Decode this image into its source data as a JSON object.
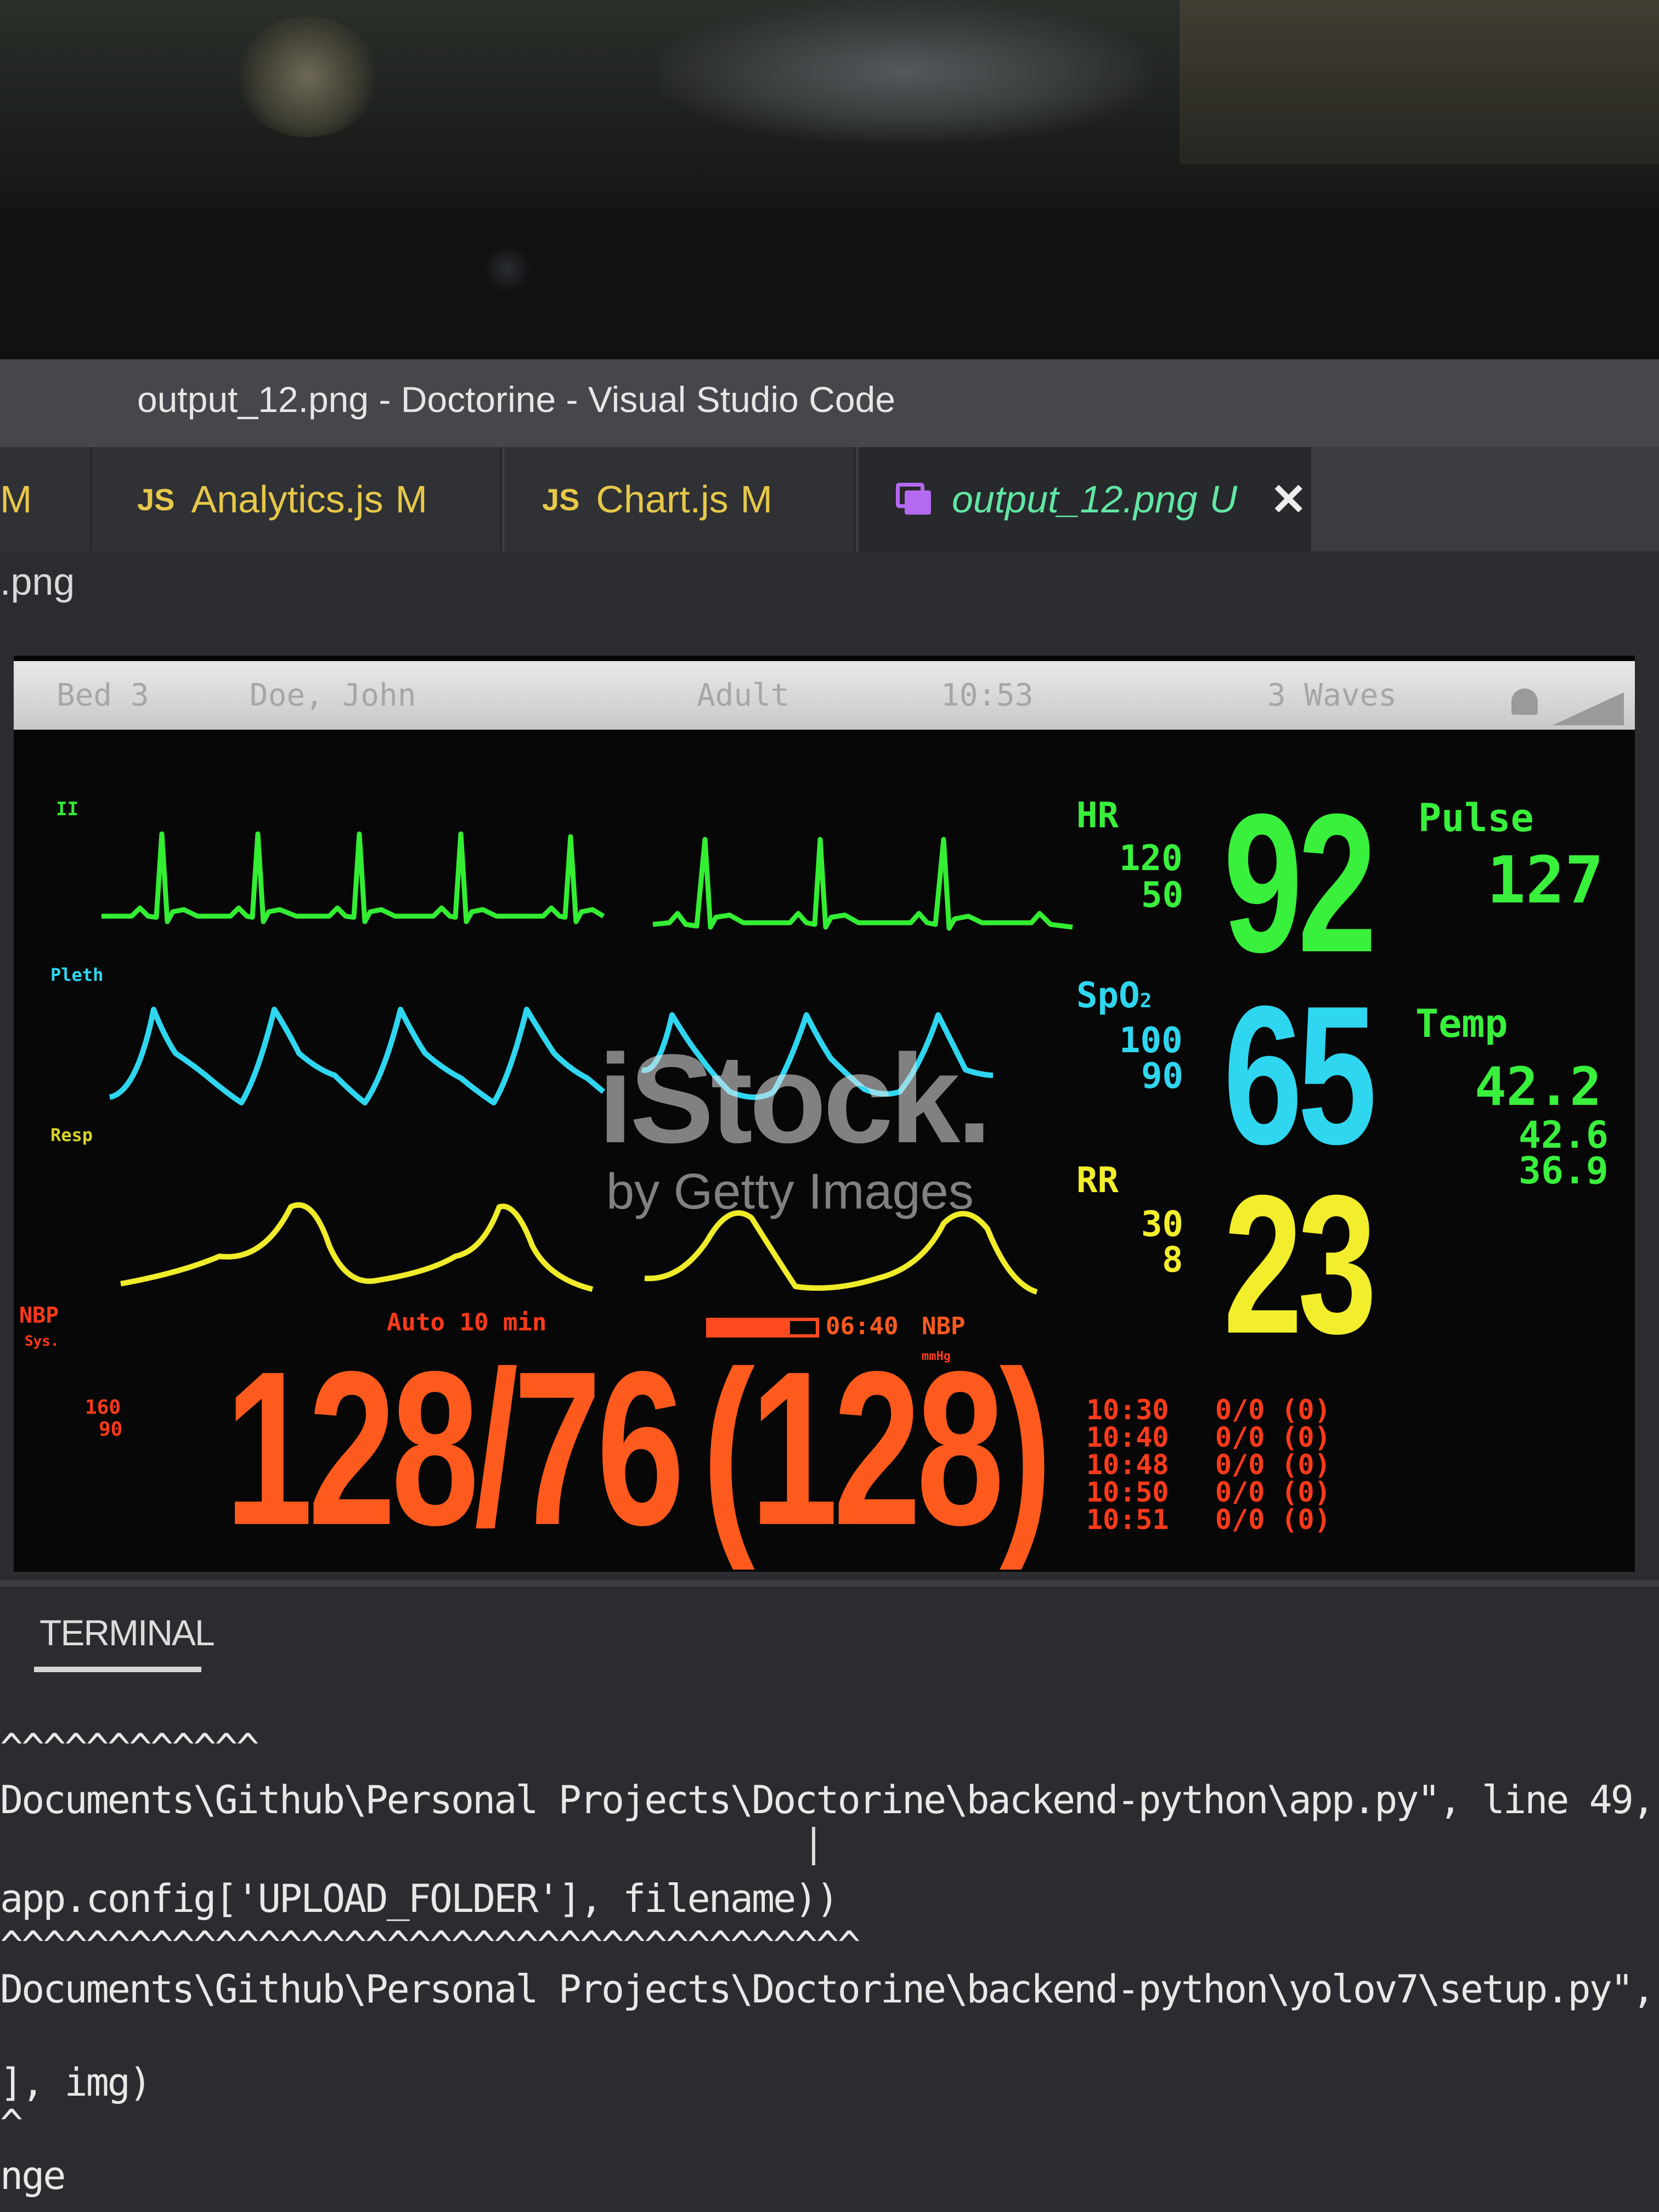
{
  "window": {
    "title": "output_12.png - Doctorine - Visual Studio Code",
    "tabs": [
      {
        "icon": "JS",
        "label": "Analytics.js",
        "status": "M"
      },
      {
        "icon": "JS",
        "label": "Chart.js",
        "status": "M"
      },
      {
        "icon": "image-icon",
        "label": "output_12.png",
        "status": "U",
        "close": "✕",
        "active": true
      }
    ],
    "partial_tab": "M",
    "breadcrumb": ".png"
  },
  "monitor": {
    "header": {
      "bed": "Bed 3",
      "patient": "Doe, John",
      "mode": "Adult",
      "time": "10:53",
      "waves": "3 Waves"
    },
    "wave_labels": {
      "ecg": "II",
      "pleth": "Pleth",
      "resp": "Resp"
    },
    "hr": {
      "label": "HR",
      "hi": "120",
      "lo": "50",
      "value": "92",
      "color": "#39f03c"
    },
    "spo2": {
      "label": "SpO",
      "sub": "2",
      "hi": "100",
      "lo": "90",
      "value": "65",
      "color": "#2fd6f0"
    },
    "rr": {
      "label": "RR",
      "hi": "30",
      "lo": "8",
      "value": "23",
      "color": "#f2ee2c"
    },
    "pulse": {
      "label": "Pulse",
      "value": "127"
    },
    "temp": {
      "label": "Temp",
      "value": "42.2",
      "v2": "42.6",
      "v3": "36.9"
    },
    "nbp": {
      "label": "NBP",
      "sub": "Sys.",
      "hi": "160",
      "lo": "90",
      "auto": "Auto 10 min",
      "timer": "06:40",
      "timer_label": "NBP",
      "unit": "mmHg",
      "value": "128/76",
      "mean": "(128)",
      "color": "#ff5a1e",
      "history": [
        {
          "time": "10:30",
          "value": "0/0 (0)"
        },
        {
          "time": "10:40",
          "value": "0/0 (0)"
        },
        {
          "time": "10:48",
          "value": "0/0 (0)"
        },
        {
          "time": "10:50",
          "value": "0/0 (0)"
        },
        {
          "time": "10:51",
          "value": "0/0 (0)"
        }
      ]
    },
    "watermark": {
      "brand": "iStock.",
      "tagline": "by Getty Images"
    }
  },
  "terminal": {
    "tab": "TERMINAL",
    "lines": [
      "^^^^^^^^^^^^",
      "Documents\\Github\\Personal Projects\\Doctorine\\backend-python\\app.py\", line 49,",
      "app.config['UPLOAD_FOLDER'], filename))",
      "^^^^^^^^^^^^^^^^^^^^^^^^^^^^^^^^^^^^^^^^",
      "Documents\\Github\\Personal Projects\\Doctorine\\backend-python\\yolov7\\setup.py\",",
      "], img)",
      "^",
      "nge"
    ]
  }
}
